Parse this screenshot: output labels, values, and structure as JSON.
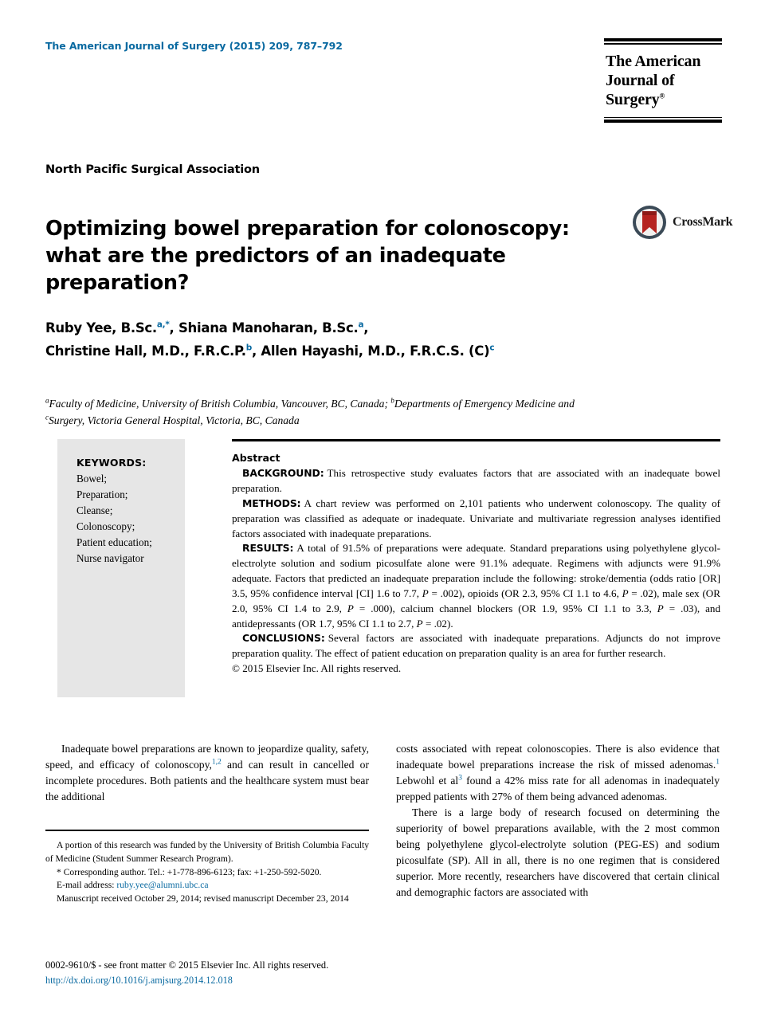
{
  "running_head": "The American Journal of Surgery (2015) 209, 787–792",
  "journal_logo": {
    "line1": "The American",
    "line2": "Journal of Surgery",
    "registered_mark": "®"
  },
  "society": "North Pacific Surgical Association",
  "title": "Optimizing bowel preparation for colonoscopy: what are the predictors of an inadequate preparation?",
  "crossmark": {
    "label": "CrossMark",
    "icon": "crossmark-icon"
  },
  "authors": {
    "line1_name1": "Ruby Yee, B.Sc.",
    "line1_sup1": "a,*",
    "line1_sep1": ", ",
    "line1_name2": "Shiana Manoharan, B.Sc.",
    "line1_sup2": "a",
    "line1_sep2": ",",
    "line2_name1": "Christine Hall, M.D., F.R.C.P.",
    "line2_sup1": "b",
    "line2_sep1": ", ",
    "line2_name2": "Allen Hayashi, M.D., F.R.C.S. (C)",
    "line2_sup2": "c"
  },
  "affiliations": {
    "sup_a": "a",
    "text_a": "Faculty of Medicine, University of British Columbia, Vancouver, BC, Canada; ",
    "sup_b": "b",
    "text_b": "Departments of Emergency Medicine and ",
    "sup_c": "c",
    "text_c": "Surgery, Victoria General Hospital, Victoria, BC, Canada"
  },
  "keywords": {
    "title": "KEYWORDS:",
    "items": [
      "Bowel;",
      "Preparation;",
      "Cleanse;",
      "Colonoscopy;",
      "Patient education;",
      "Nurse navigator"
    ]
  },
  "abstract": {
    "heading": "Abstract",
    "background_label": "BACKGROUND:",
    "background_text": "This retrospective study evaluates factors that are associated with an inadequate bowel preparation.",
    "methods_label": "METHODS:",
    "methods_text": "A chart review was performed on 2,101 patients who underwent colonoscopy. The quality of preparation was classified as adequate or inadequate. Univariate and multivariate regression analyses identified factors associated with inadequate preparations.",
    "results_label": "RESULTS:",
    "results_text_1": "A total of 91.5% of preparations were adequate. Standard preparations using polyethylene glycol-electrolyte solution and sodium picosulfate alone were 91.1% adequate. Regimens with adjuncts were 91.9% adequate. Factors that predicted an inadequate preparation include the following: stroke/dementia (odds ratio [OR] 3.5, 95% confidence interval [CI] 1.6 to 7.7, ",
    "results_p1": "P",
    "results_text_2": " = .002), opioids (OR 2.3, 95% CI 1.1 to 4.6, ",
    "results_p2": "P",
    "results_text_3": " = .02), male sex (OR 2.0, 95% CI 1.4 to 2.9, ",
    "results_p3": "P",
    "results_text_4": " = .000), calcium channel blockers (OR 1.9, 95% CI 1.1 to 3.3, ",
    "results_p4": "P",
    "results_text_5": " = .03), and antidepressants (OR 1.7, 95% CI 1.1 to 2.7, ",
    "results_p5": "P",
    "results_text_6": " = .02).",
    "conclusions_label": "CONCLUSIONS:",
    "conclusions_text": "Several factors are associated with inadequate preparations. Adjuncts do not improve preparation quality. The effect of patient education on preparation quality is an area for further research.",
    "copyright": "© 2015 Elsevier Inc. All rights reserved."
  },
  "body": {
    "left_para_1a": "Inadequate bowel preparations are known to jeopardize quality, safety, speed, and efficacy of colonoscopy,",
    "left_para_1_cite": "1,2",
    "left_para_1b": " and can result in cancelled or incomplete procedures. Both patients and the healthcare system must bear the additional",
    "right_para_1a": "costs associated with repeat colonoscopies. There is also evidence that inadequate bowel preparations increase the risk of missed adenomas.",
    "right_para_1_cite1": "1",
    "right_para_1b": " Lebwohl et al",
    "right_para_1_cite2": "3",
    "right_para_1c": " found a 42% miss rate for all adenomas in inadequately prepped patients with 27% of them being advanced adenomas.",
    "right_para_2": "There is a large body of research focused on determining the superiority of bowel preparations available, with the 2 most common being polyethylene glycol-electrolyte solution (PEG-ES) and sodium picosulfate (SP). All in all, there is no one regimen that is considered superior. More recently, researchers have discovered that certain clinical and demographic factors are associated with"
  },
  "footnotes": {
    "funding": "A portion of this research was funded by the University of British Columbia Faculty of Medicine (Student Summer Research Program).",
    "corresponding_marker": "*",
    "corresponding": "Corresponding author. Tel.: +1-778-896-6123; fax: +1-250-592-5020.",
    "email_label": "E-mail address:",
    "email": "ruby.yee@alumni.ubc.ca",
    "manuscript_dates": "Manuscript received October 29, 2014; revised manuscript December 23, 2014"
  },
  "footer": {
    "issn_line": "0002-9610/$ - see front matter © 2015 Elsevier Inc. All rights reserved.",
    "doi": "http://dx.doi.org/10.1016/j.amjsurg.2014.12.018"
  },
  "colors": {
    "link_blue": "#0a6aa1",
    "keywords_panel": "#e6e6e6",
    "crossmark_ribbon": "#b5231f",
    "crossmark_ring": "#3b4a57"
  }
}
